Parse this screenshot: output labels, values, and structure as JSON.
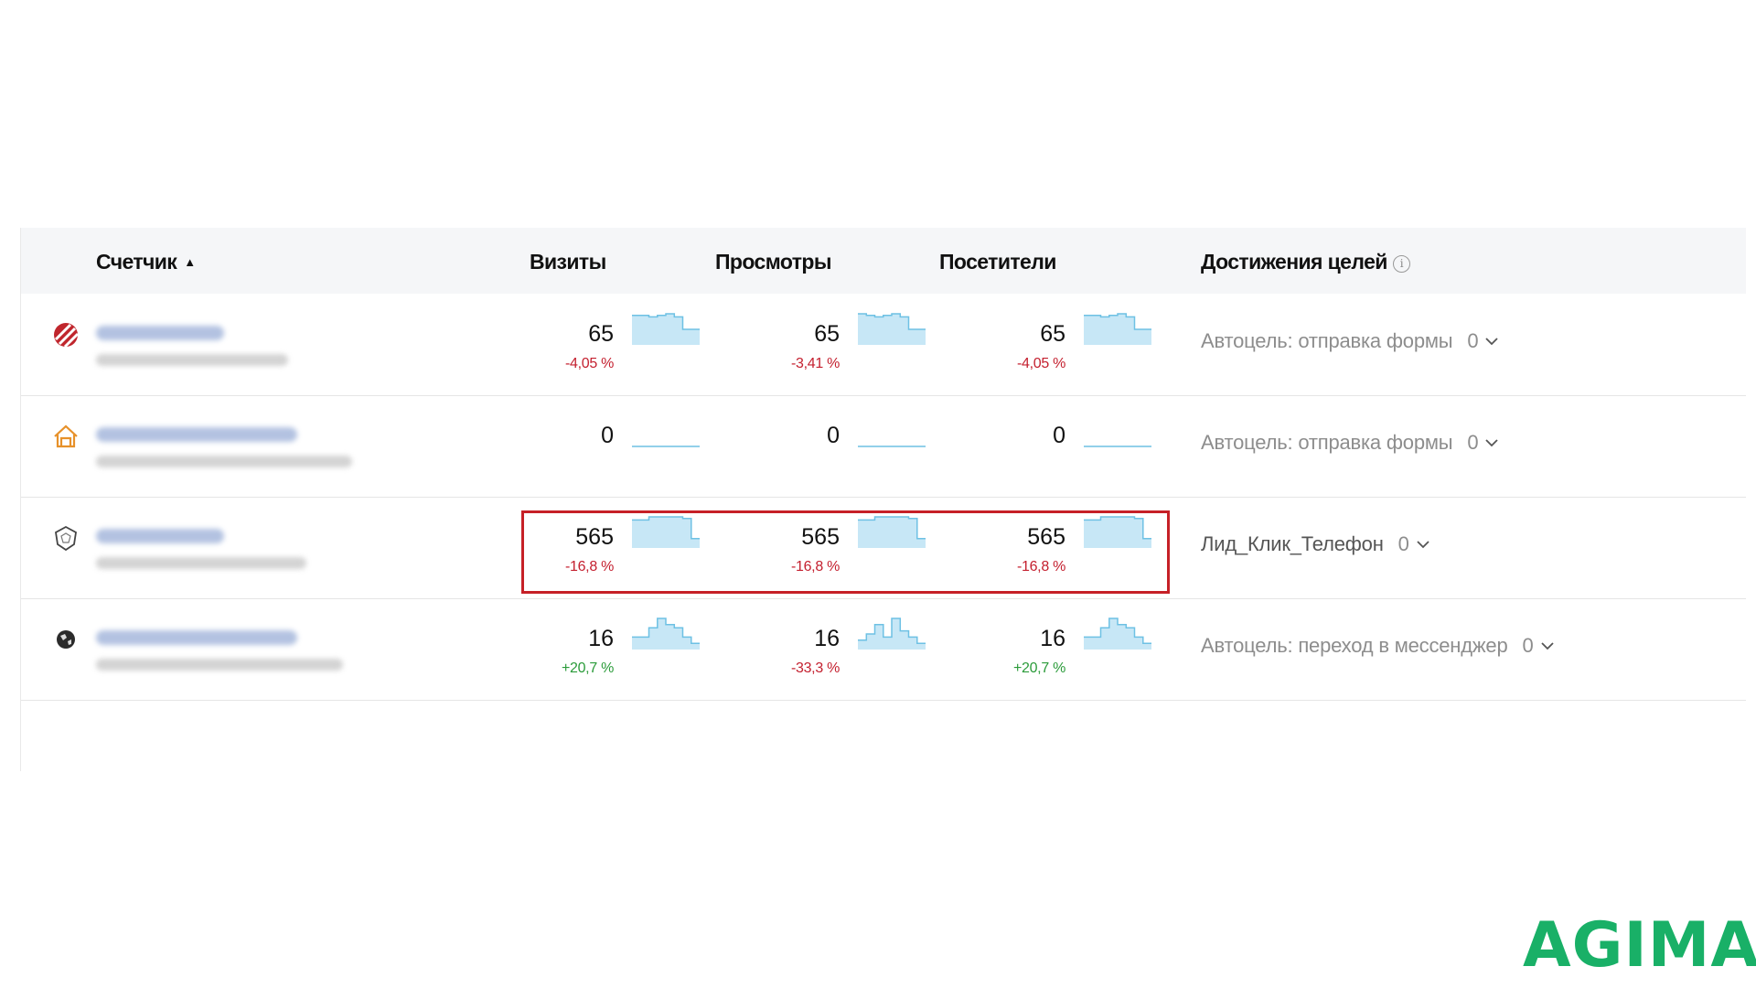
{
  "header": {
    "counter_label": "Счетчик",
    "sort_indicator": "▲",
    "visits_label": "Визиты",
    "views_label": "Просмотры",
    "visitors_label": "Посетители",
    "goals_label": "Достижения целей",
    "goals_info_icon": "info-icon",
    "info_glyph": "i"
  },
  "colors": {
    "negative": "#c4202f",
    "positive": "#2b9b3a",
    "sparkline_fill": "#c7e7f6",
    "sparkline_line": "#6ec1e4",
    "highlight_border": "#c62027",
    "logo": "#19b067"
  },
  "rows": [
    {
      "icon": "red-striped-logo-icon",
      "visits": "65",
      "visits_change": "-4,05 %",
      "visits_trend": "neg",
      "visits_spark": [
        0.95,
        0.95,
        0.9,
        0.95,
        1.0,
        0.9,
        0.5,
        0.5
      ],
      "views": "65",
      "views_change": "-3,41 %",
      "views_trend": "neg",
      "views_spark": [
        1.0,
        0.95,
        0.9,
        0.95,
        1.0,
        0.9,
        0.5,
        0.5
      ],
      "visitors": "65",
      "visitors_change": "-4,05 %",
      "visitors_trend": "neg",
      "visitors_spark": [
        0.95,
        0.95,
        0.9,
        0.95,
        1.0,
        0.9,
        0.5,
        0.5
      ],
      "goal_name": "Автоцель: отправка формы",
      "goal_count": "0"
    },
    {
      "icon": "orange-house-logo-icon",
      "visits": "0",
      "visits_change": "",
      "visits_trend": "neg",
      "visits_spark": [
        0,
        0,
        0,
        0,
        0,
        0,
        0,
        0
      ],
      "views": "0",
      "views_change": "",
      "views_trend": "neg",
      "views_spark": [
        0,
        0,
        0,
        0,
        0,
        0,
        0,
        0
      ],
      "visitors": "0",
      "visitors_change": "",
      "visitors_trend": "neg",
      "visitors_spark": [
        0,
        0,
        0,
        0,
        0,
        0,
        0,
        0
      ],
      "goal_name": "Автоцель: отправка формы",
      "goal_count": "0"
    },
    {
      "icon": "shield-logo-icon",
      "visits": "565",
      "visits_change": "-16,8 %",
      "visits_trend": "neg",
      "visits_spark": [
        0.9,
        0.9,
        1.0,
        1.0,
        1.0,
        1.0,
        0.95,
        0.3
      ],
      "views": "565",
      "views_change": "-16,8 %",
      "views_trend": "neg",
      "views_spark": [
        0.9,
        0.9,
        1.0,
        1.0,
        1.0,
        1.0,
        0.95,
        0.3
      ],
      "visitors": "565",
      "visitors_change": "-16,8 %",
      "visitors_trend": "neg",
      "visitors_spark": [
        0.9,
        0.9,
        1.0,
        1.0,
        1.0,
        1.0,
        0.95,
        0.3
      ],
      "goal_name": "Лид_Клик_Телефон",
      "goal_count": "0"
    },
    {
      "icon": "globe-logo-icon",
      "visits": "16",
      "visits_change": "+20,7 %",
      "visits_trend": "pos",
      "visits_spark": [
        0.4,
        0.4,
        0.7,
        1.0,
        0.8,
        0.7,
        0.4,
        0.2
      ],
      "views": "16",
      "views_change": "-33,3 %",
      "views_trend": "neg",
      "views_spark": [
        0.3,
        0.5,
        0.8,
        0.4,
        1.0,
        0.6,
        0.4,
        0.2
      ],
      "visitors": "16",
      "visitors_change": "+20,7 %",
      "visitors_trend": "pos",
      "visitors_spark": [
        0.4,
        0.4,
        0.7,
        1.0,
        0.8,
        0.7,
        0.4,
        0.2
      ],
      "goal_name": "Автоцель: переход в мессенджер",
      "goal_count": "0"
    }
  ],
  "logo_text": "AGIMA"
}
